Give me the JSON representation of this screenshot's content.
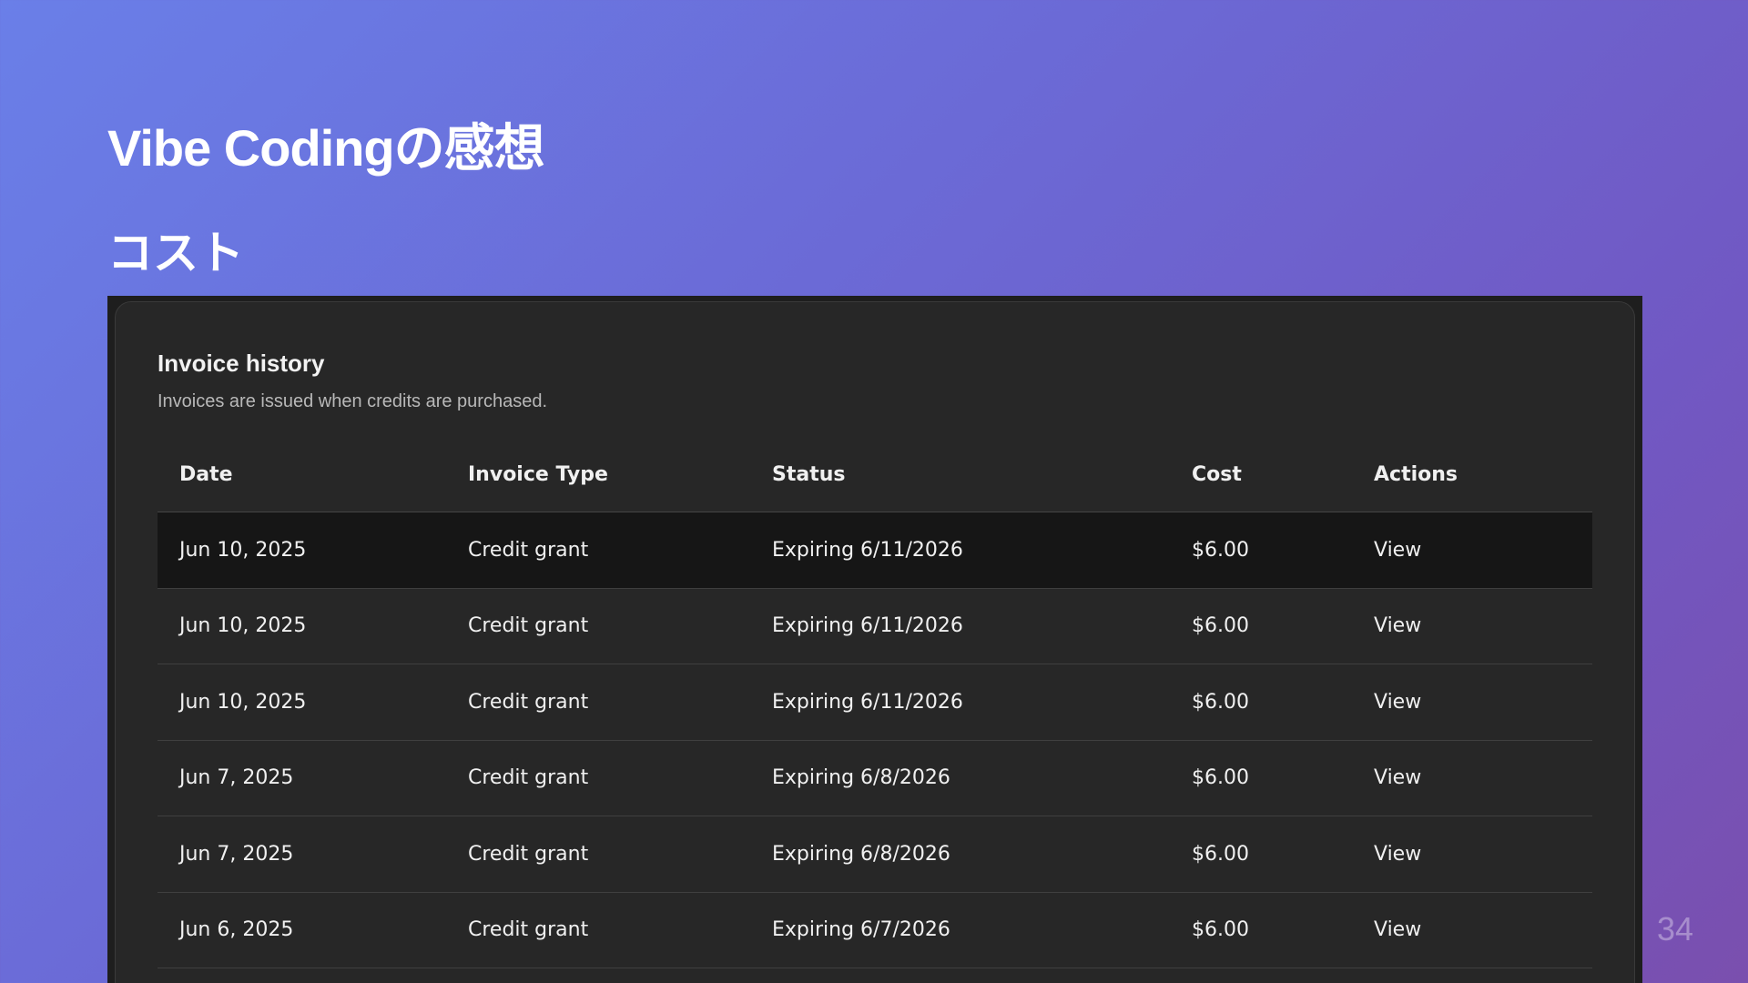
{
  "slide": {
    "title": "Vibe Codingの感想",
    "subtitle": "コスト",
    "page_number": "34"
  },
  "panel": {
    "title": "Invoice history",
    "description": "Invoices are issued when credits are purchased."
  },
  "table": {
    "headers": {
      "date": "Date",
      "type": "Invoice Type",
      "status": "Status",
      "cost": "Cost",
      "actions": "Actions"
    },
    "rows": [
      {
        "date": "Jun 10, 2025",
        "type": "Credit grant",
        "status": "Expiring 6/11/2026",
        "cost": "$6.00",
        "action": "View"
      },
      {
        "date": "Jun 10, 2025",
        "type": "Credit grant",
        "status": "Expiring 6/11/2026",
        "cost": "$6.00",
        "action": "View"
      },
      {
        "date": "Jun 10, 2025",
        "type": "Credit grant",
        "status": "Expiring 6/11/2026",
        "cost": "$6.00",
        "action": "View"
      },
      {
        "date": "Jun 7, 2025",
        "type": "Credit grant",
        "status": "Expiring 6/8/2026",
        "cost": "$6.00",
        "action": "View"
      },
      {
        "date": "Jun 7, 2025",
        "type": "Credit grant",
        "status": "Expiring 6/8/2026",
        "cost": "$6.00",
        "action": "View"
      },
      {
        "date": "Jun 6, 2025",
        "type": "Credit grant",
        "status": "Expiring 6/7/2026",
        "cost": "$6.00",
        "action": "View"
      }
    ]
  }
}
